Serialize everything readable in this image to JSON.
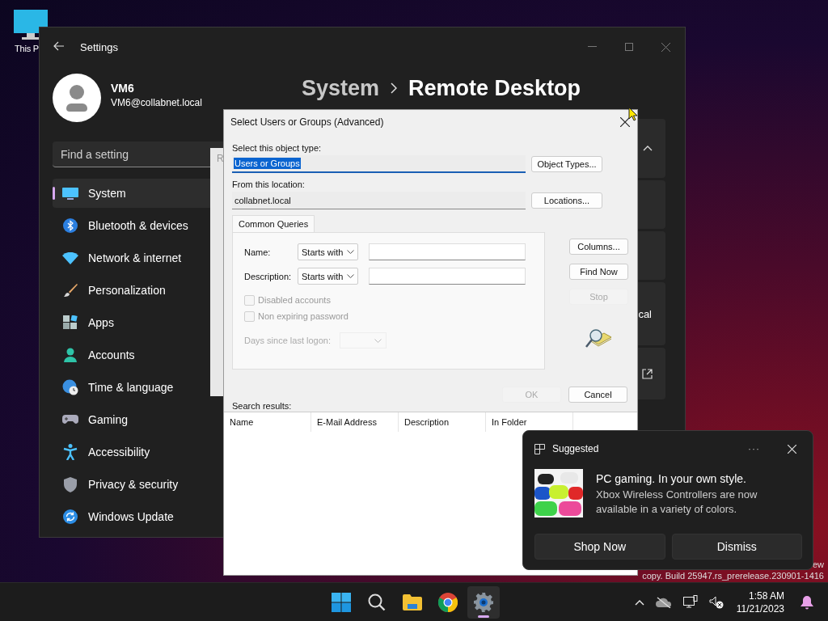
{
  "desktop": {
    "icons": [
      {
        "label": "This P"
      }
    ],
    "watermark": [
      "ew",
      "copy. Build 25947.rs_prerelease.230901-1416"
    ]
  },
  "settings": {
    "title": "Settings",
    "user": {
      "name": "VM6",
      "email": "VM6@collabnet.local"
    },
    "search": {
      "placeholder": "Find a setting"
    },
    "nav": [
      {
        "label": "System",
        "kind": "system",
        "selected": true
      },
      {
        "label": "Bluetooth & devices",
        "kind": "bluetooth",
        "selected": false
      },
      {
        "label": "Network & internet",
        "kind": "network",
        "selected": false
      },
      {
        "label": "Personalization",
        "kind": "brush",
        "selected": false
      },
      {
        "label": "Apps",
        "kind": "apps",
        "selected": false
      },
      {
        "label": "Accounts",
        "kind": "accounts",
        "selected": false
      },
      {
        "label": "Time & language",
        "kind": "time",
        "selected": false
      },
      {
        "label": "Gaming",
        "kind": "gaming",
        "selected": false
      },
      {
        "label": "Accessibility",
        "kind": "accessibility",
        "selected": false
      },
      {
        "label": "Privacy & security",
        "kind": "shield",
        "selected": false
      },
      {
        "label": "Windows Update",
        "kind": "update",
        "selected": false
      }
    ],
    "breadcrumb": [
      "System",
      "Remote Desktop"
    ],
    "cards": [
      {
        "kind": "expander"
      },
      {
        "kind": "blank"
      },
      {
        "kind": "blank"
      },
      {
        "kind": "text",
        "fragment": "cal"
      },
      {
        "kind": "link"
      }
    ]
  },
  "back_window": {
    "fragment": "R"
  },
  "dialog": {
    "title": "Select Users or Groups (Advanced)",
    "object_type": {
      "label": "Select this object type:",
      "value": "Users or Groups",
      "text_selected": true,
      "button": "Object Types..."
    },
    "location": {
      "label": "From this location:",
      "value": "collabnet.local",
      "text_selected": false,
      "button": "Locations..."
    },
    "tab": "Common Queries",
    "queries": [
      {
        "label": "Name:",
        "operator": "Starts with"
      },
      {
        "label": "Description:",
        "operator": "Starts with"
      }
    ],
    "checkboxes": [
      {
        "label": "Disabled accounts",
        "checked": false,
        "disabled": true
      },
      {
        "label": "Non expiring password",
        "checked": false,
        "disabled": true
      }
    ],
    "days_since_logon": {
      "label": "Days since last logon:",
      "disabled": true
    },
    "side_buttons": [
      {
        "label": "Columns...",
        "disabled": false
      },
      {
        "label": "Find Now",
        "disabled": false
      },
      {
        "label": "Stop",
        "disabled": true
      }
    ],
    "buttons": [
      {
        "label": "OK",
        "disabled": true
      },
      {
        "label": "Cancel",
        "disabled": false
      }
    ],
    "results_label": "Search results:",
    "columns": [
      "Name",
      "E-Mail Address",
      "Description",
      "In Folder"
    ]
  },
  "notification": {
    "source": "Suggested",
    "more": "···",
    "title": "PC gaming. In your own style.",
    "body": "Xbox Wireless Controllers are now available in a variety of colors.",
    "picture": {
      "kind": "picture"
    },
    "buttons": [
      "Shop Now",
      "Dismiss"
    ]
  },
  "taskbar": {
    "apps": [
      {
        "kind": "start",
        "selected": false
      },
      {
        "kind": "search",
        "selected": false
      },
      {
        "kind": "explorer",
        "selected": false
      },
      {
        "kind": "chrome",
        "selected": false
      },
      {
        "kind": "settings",
        "selected": true
      }
    ],
    "time": "1:58 AM",
    "date": "11/21/2023"
  }
}
